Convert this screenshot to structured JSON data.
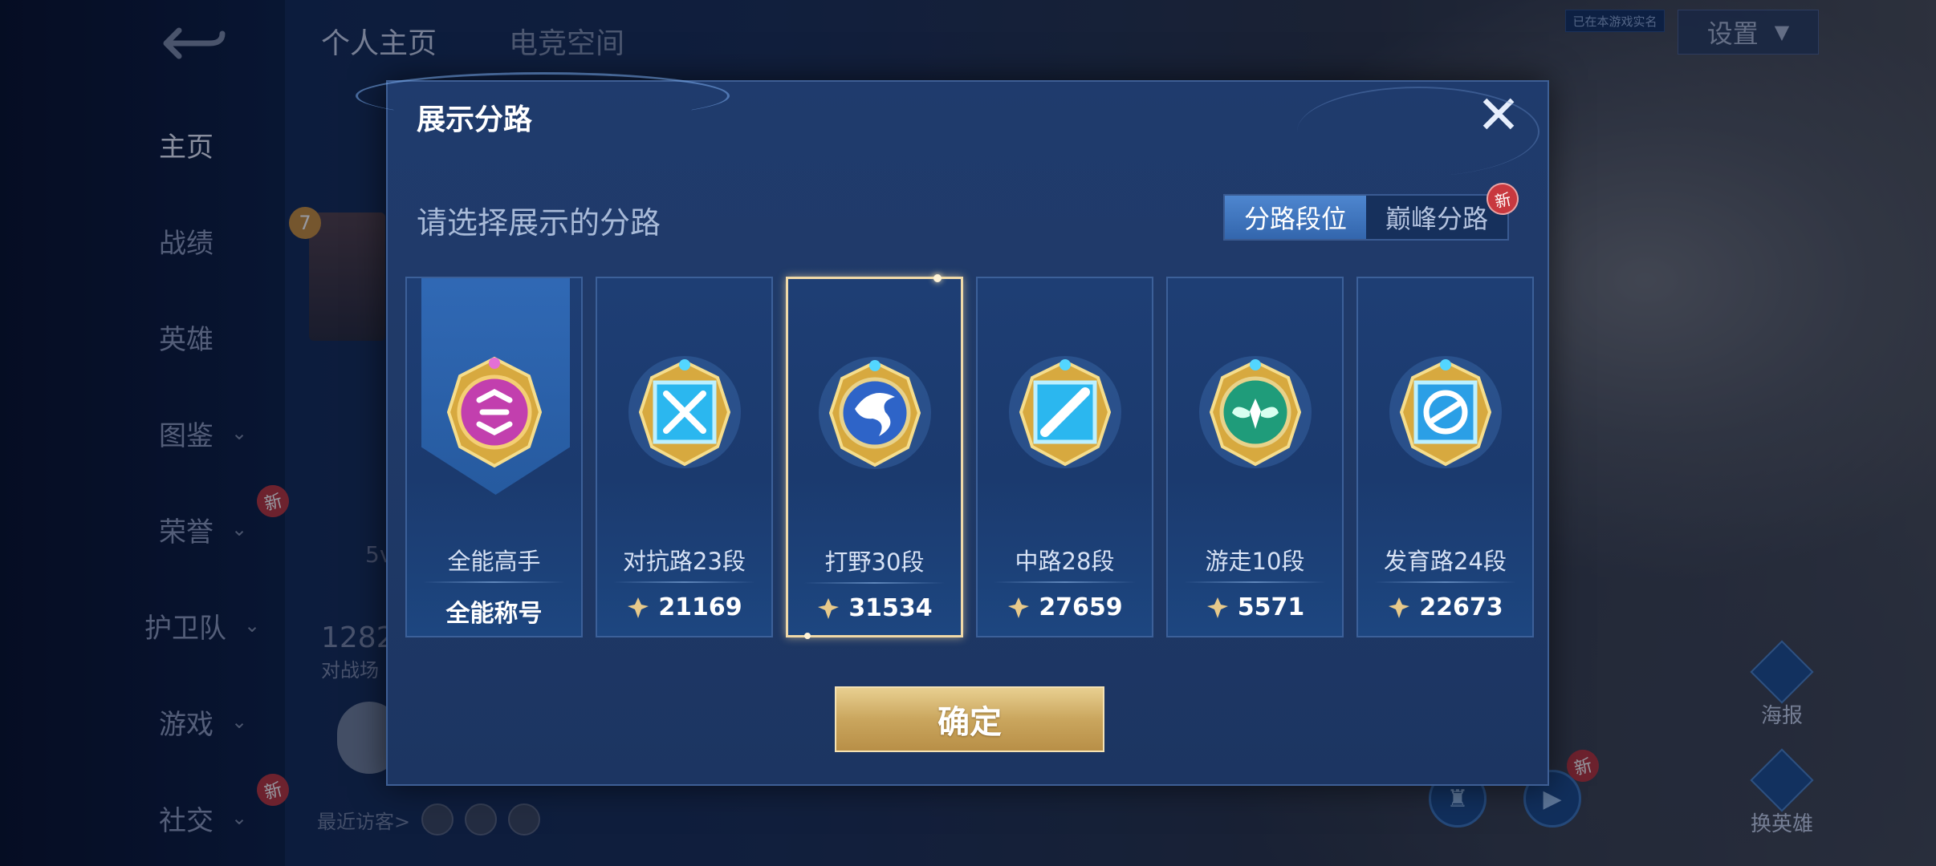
{
  "background": {
    "back_icon": "back-arrow-icon",
    "top_tabs": [
      "个人主页",
      "电竞空间"
    ],
    "sidebar": {
      "items": [
        {
          "label": "主页",
          "active": true
        },
        {
          "label": "战绩"
        },
        {
          "label": "英雄"
        },
        {
          "label": "图鉴",
          "expandable": true
        },
        {
          "label": "荣誉",
          "expandable": true,
          "badge": "新"
        },
        {
          "label": "护卫队",
          "expandable": true
        },
        {
          "label": "游戏",
          "expandable": true
        },
        {
          "label": "社交",
          "expandable": true,
          "badge": "新"
        }
      ]
    },
    "settings_label": "设置",
    "realname_label": "已在本游戏实名",
    "level_badge": "7",
    "mode_text": "5v",
    "stat_number": "1282",
    "stat_label": "对战场",
    "recent_visitors_label": "最近访客>",
    "right_buttons": [
      {
        "label": "海报"
      },
      {
        "label": "换英雄"
      }
    ],
    "new_badge_text": "新"
  },
  "modal": {
    "title": "展示分路",
    "close_icon": "close-x-icon",
    "subtitle": "请选择展示的分路",
    "toggle": {
      "options": [
        "分路段位",
        "巅峰分路"
      ],
      "selected_index": 0,
      "new_badge": "新"
    },
    "cards": [
      {
        "name": "全能高手",
        "footer": "全能称号",
        "emblem_icon": "all-round-emblem-icon",
        "color": "#c23fae"
      },
      {
        "name": "对抗路23段",
        "score": "21169",
        "emblem_icon": "clash-lane-emblem-icon",
        "color": "#2bb7ef"
      },
      {
        "name": "打野30段",
        "score": "31534",
        "emblem_icon": "jungle-dragon-emblem-icon",
        "color": "#2e64c8",
        "selected": true
      },
      {
        "name": "中路28段",
        "score": "27659",
        "emblem_icon": "mid-lane-emblem-icon",
        "color": "#2bb7ef"
      },
      {
        "name": "游走10段",
        "score": "5571",
        "emblem_icon": "roam-wings-emblem-icon",
        "color": "#1f9c7a"
      },
      {
        "name": "发育路24段",
        "score": "22673",
        "emblem_icon": "farm-lane-emblem-icon",
        "color": "#2b9fe6"
      }
    ],
    "score_icon": "power-score-icon",
    "confirm_label": "确定"
  },
  "colors": {
    "accent_gold": "#caa65e",
    "modal_bg": "#1f3b6d",
    "toggle_on": "#3f76bf",
    "badge_red": "#c8383f"
  }
}
